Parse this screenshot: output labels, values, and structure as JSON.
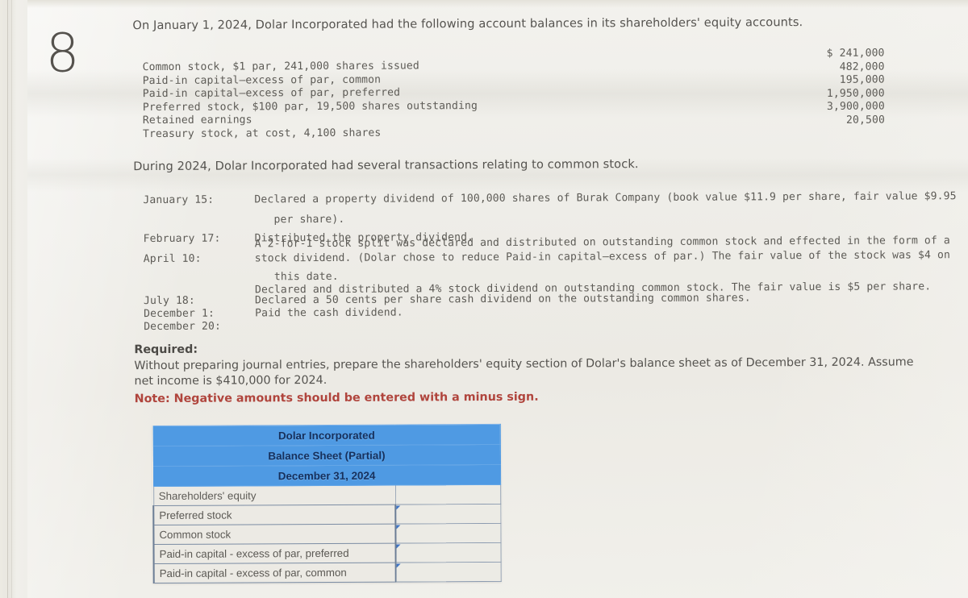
{
  "page": {
    "number": "8"
  },
  "intro": {
    "line": "On January 1, 2024, Dolar Incorporated had the following account balances in its shareholders' equity accounts."
  },
  "balances": {
    "rows": [
      {
        "label": "Common stock, $1 par, 241,000 shares issued",
        "amount": "$ 241,000"
      },
      {
        "label": "Paid-in capital–excess of par, common",
        "amount": "482,000"
      },
      {
        "label": "Paid-in capital–excess of par, preferred",
        "amount": "195,000"
      },
      {
        "label": "Preferred stock, $100 par, 19,500 shares outstanding",
        "amount": "1,950,000"
      },
      {
        "label": "Retained earnings",
        "amount": "3,900,000"
      },
      {
        "label": "Treasury stock, at cost, 4,100 shares",
        "amount": "20,500"
      }
    ]
  },
  "during": {
    "line": "During 2024, Dolar Incorporated had several transactions relating to common stock."
  },
  "transactions": [
    {
      "date": "January 15:",
      "lines": [
        "Declared a property dividend of 100,000 shares of Burak Company (book value $11.9 per share, fair value $9.95",
        "per share)."
      ]
    },
    {
      "date": "February 17:",
      "lines": [
        "Distributed the property dividend."
      ]
    },
    {
      "date": "April 10:",
      "lines": [
        "A 2-for-1 stock split was declared and distributed on outstanding common stock and effected in the form of a",
        "stock dividend. (Dolar chose to reduce Paid-in capital–excess of par.) The fair value of the stock was $4 on",
        "this date."
      ]
    },
    {
      "date": "July 18:",
      "lines": [
        "Declared and distributed a 4% stock dividend on outstanding common stock. The fair value is $5 per share."
      ]
    },
    {
      "date": "December 1:",
      "lines": [
        "Declared a 50 cents per share cash dividend on the outstanding common shares."
      ]
    },
    {
      "date": "December 20:",
      "lines": [
        "Paid the cash dividend."
      ]
    }
  ],
  "required": {
    "heading": "Required:",
    "body_line_1": "Without preparing journal entries, prepare the shareholders' equity section of Dolar's balance sheet as of December 31, 2024. Assume",
    "body_line_2": "net income is $410,000 for 2024.",
    "note": "Note: Negative amounts should be entered with a minus sign."
  },
  "balance_sheet": {
    "header": [
      "Dolar Incorporated",
      "Balance Sheet (Partial)",
      "December 31, 2024"
    ],
    "rows": [
      {
        "label": "Shareholders' equity",
        "value": "",
        "type": "section"
      },
      {
        "label": "Preferred stock",
        "value": "",
        "type": "entry"
      },
      {
        "label": "Common stock",
        "value": "",
        "type": "entry"
      },
      {
        "label": "Paid-in capital - excess of par, preferred",
        "value": "",
        "type": "entry"
      },
      {
        "label": "Paid-in capital - excess of par, common",
        "value": "",
        "type": "entry"
      }
    ]
  },
  "colors": {
    "header_blue": "#4f9ae3",
    "header_text": "#16305c",
    "note_red": "#b0453d",
    "paper": "#efeee9"
  }
}
